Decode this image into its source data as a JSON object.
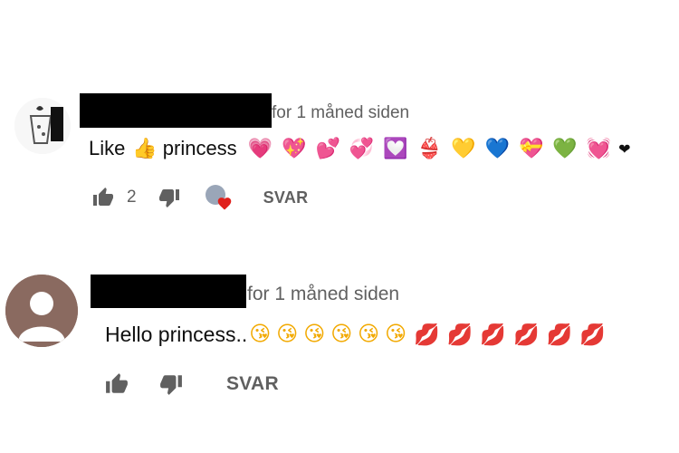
{
  "comments": [
    {
      "author": "",
      "timestamp": "for 1 måned siden",
      "text": "Like",
      "text_after": "princess",
      "emojis_a": [
        "👍"
      ],
      "emojis_b": [
        "💗",
        "💖",
        "💕",
        "💞",
        "💟",
        "👙",
        "💛",
        "💙",
        "💝",
        "💚",
        "💓",
        "❤"
      ],
      "likes": "2",
      "reply_label": "SVAR"
    },
    {
      "author": "",
      "timestamp": "for 1 måned siden",
      "text": "Hello princess..",
      "emojis_b": [
        "😘",
        "😘",
        "😘",
        "😘",
        "😘",
        "😘",
        "💋",
        "💋",
        "💋",
        "💋",
        "💋",
        "💋"
      ],
      "reply_label": "SVAR"
    }
  ],
  "colors": {
    "like_icon": "#606060",
    "heart_badge": "#e0201c",
    "redaction": "#000000"
  }
}
